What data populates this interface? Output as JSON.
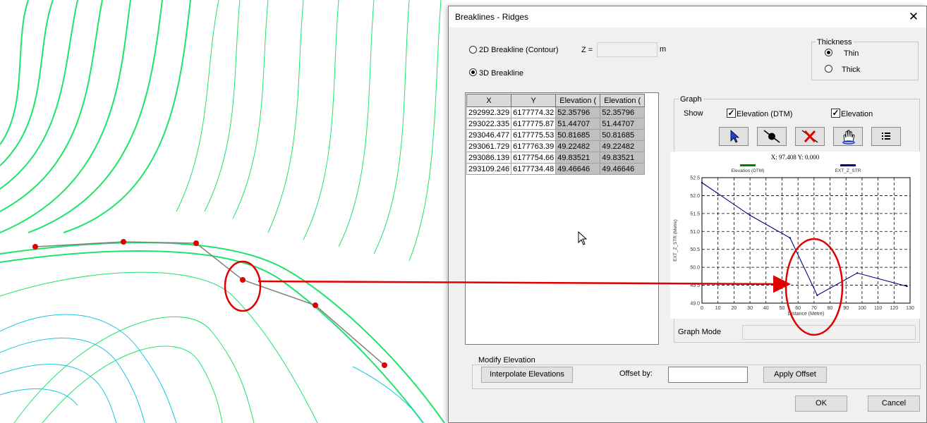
{
  "dialog": {
    "title": "Breaklines - Ridges",
    "close_glyph": "✕"
  },
  "mode": {
    "option_2d": "2D Breakline (Contour)",
    "option_3d": "3D Breakline",
    "selected": "3D Breakline",
    "z_label": "Z =",
    "z_value": "",
    "z_unit": "m"
  },
  "thickness": {
    "group_label": "Thickness",
    "options": [
      "Thin",
      "Thick"
    ],
    "selected": "Thin"
  },
  "table": {
    "columns": [
      "X",
      "Y",
      "Elevation (",
      "Elevation ("
    ],
    "rows": [
      [
        "292992.329",
        "6177774.32",
        "52.35796",
        "52.35796"
      ],
      [
        "293022.335",
        "6177775.87",
        "51.44707",
        "51.44707"
      ],
      [
        "293046.477",
        "6177775.53",
        "50.81685",
        "50.81685"
      ],
      [
        "293061.729",
        "6177763.39",
        "49.22482",
        "49.22482"
      ],
      [
        "293086.139",
        "6177754.66",
        "49.83521",
        "49.83521"
      ],
      [
        "293109.246",
        "6177734.48",
        "49.46646",
        "49.46646"
      ]
    ]
  },
  "graph": {
    "group_label": "Graph",
    "show_label": "Show",
    "checks": [
      {
        "label": "Elevation (DTM)",
        "checked": true
      },
      {
        "label": "Elevation",
        "checked": true
      }
    ],
    "tools": [
      {
        "name": "select-arrow-icon"
      },
      {
        "name": "add-point-icon"
      },
      {
        "name": "delete-point-icon"
      },
      {
        "name": "pan-hand-icon"
      },
      {
        "name": "list-icon"
      }
    ],
    "mode_label": "Graph Mode",
    "mode_value": ""
  },
  "chart_data": {
    "type": "line",
    "readout": "X: 97.408 Y: 0.000",
    "legend": [
      {
        "name": "Elevation (DTM)",
        "color": "#008000"
      },
      {
        "name": "EXT_Z_STR",
        "color": "#000080"
      }
    ],
    "xlabel": "Distance (Metre)",
    "ylabel": "EXT_Z_STR (Metre)",
    "xlim": [
      0,
      130
    ],
    "ylim": [
      49.0,
      52.5
    ],
    "xticks": [
      "0",
      "10",
      "20",
      "30",
      "40",
      "50",
      "60",
      "70",
      "80",
      "90",
      "100",
      "110",
      "120",
      "130"
    ],
    "yticks": [
      "49.0",
      "49.5",
      "50.0",
      "50.5",
      "51.0",
      "51.5",
      "52.0",
      "52.5"
    ],
    "grid": true,
    "series": [
      {
        "name": "EXT_Z_STR",
        "color": "#000080",
        "x": [
          0,
          30,
          55,
          72,
          97,
          128
        ],
        "y": [
          52.36,
          51.45,
          50.82,
          49.22,
          49.84,
          49.47
        ]
      }
    ]
  },
  "modify": {
    "group_label": "Modify Elevation",
    "interpolate_button": "Interpolate Elevations",
    "offset_label": "Offset by:",
    "offset_value": "",
    "apply_button": "Apply Offset"
  },
  "buttons": {
    "ok": "OK",
    "cancel": "Cancel"
  },
  "colors": {
    "contour_green": "#00e676",
    "contour_cyan": "#00bcd4",
    "annotation_red": "#e00000"
  }
}
